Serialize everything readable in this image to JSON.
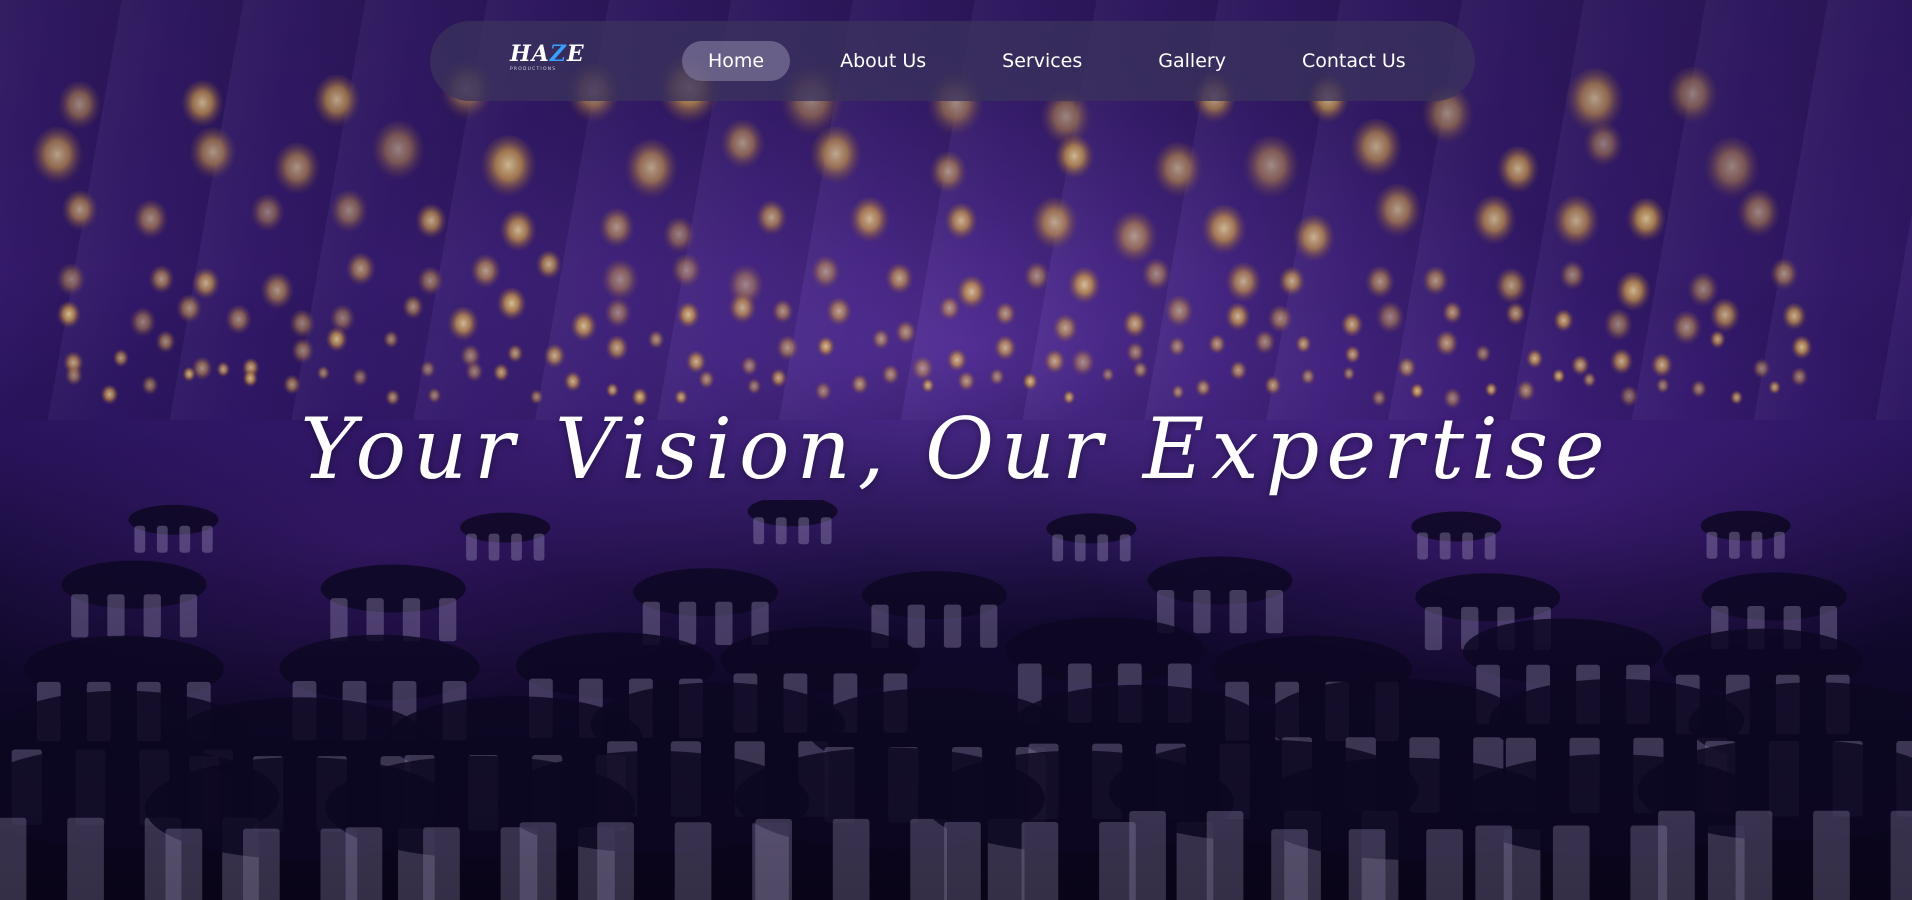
{
  "logo": {
    "title": "HAZE",
    "tagline": "PRODUCTIONS"
  },
  "nav": {
    "items": [
      {
        "label": "Home",
        "active": true
      },
      {
        "label": "About Us",
        "active": false
      },
      {
        "label": "Services",
        "active": false
      },
      {
        "label": "Gallery",
        "active": false
      },
      {
        "label": "Contact Us",
        "active": false
      }
    ]
  },
  "hero": {
    "headline": "Your Vision, Our Expertise",
    "background": "event-hall-photo"
  },
  "colors": {
    "nav_bg": "#3a325c",
    "active_pill": "#787096",
    "text": "#ffffff",
    "hero_tint": "#2a1560",
    "logo_accent": "#3aa0ff"
  }
}
